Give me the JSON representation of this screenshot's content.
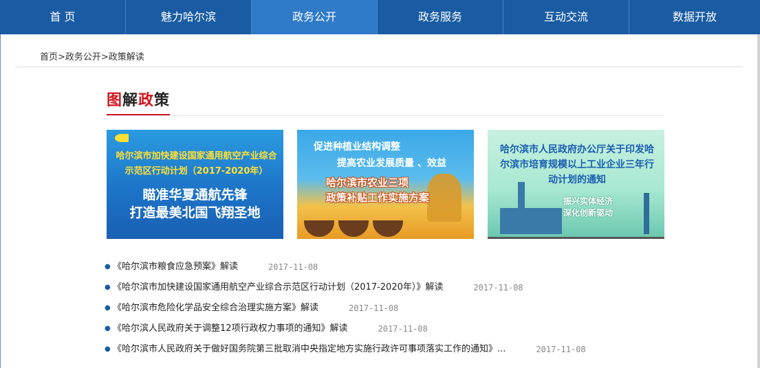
{
  "nav": {
    "items": [
      "首 页",
      "魅力哈尔滨",
      "政务公开",
      "政务服务",
      "互动交流",
      "数据开放"
    ],
    "active_index": 2
  },
  "breadcrumb": "首页>政务公开>政策解读",
  "section_title": {
    "part1": "图",
    "part2": "解",
    "part3": "政",
    "part4": "策"
  },
  "banners": [
    {
      "line1": "哈尔滨市加快建设国家通用航空产业综合示范区行动计划（2017-2020年）",
      "line2": "瞄准华夏通航先锋",
      "line3": "打造最美北国飞翔圣地"
    },
    {
      "line1": "促进种植业结构调整",
      "line2": "提高农业发展质量 、效益",
      "line3": "哈尔滨市农业三项",
      "line4": "政策补贴工作实施方案"
    },
    {
      "line1": "哈尔滨市人民政府办公厅关于印发哈尔滨市培育规模以上工业企业三年行动计划的通知",
      "line2": "振兴实体经济",
      "line3": "深化创新驱动"
    }
  ],
  "items": [
    {
      "title": "《哈尔滨市粮食应急预案》解读",
      "date": "2017-11-08"
    },
    {
      "title": "《哈尔滨市加快建设国家通用航空产业综合示范区行动计划（2017-2020年）》解读",
      "date": "2017-11-08"
    },
    {
      "title": "《哈尔滨市危险化学品安全综合治理实施方案》解读",
      "date": "2017-11-08"
    },
    {
      "title": "《哈尔滨人民政府关于调整12项行政权力事项的通知》解读",
      "date": "2017-11-08"
    },
    {
      "title": "《哈尔滨市人民政府关于做好国务院第三批取消中央指定地方实施行政许可事项落实工作的通知》...",
      "date": "2017-11-08"
    }
  ],
  "colors": {
    "nav": "#1a5ca4",
    "nav_active": "#2f7bc9",
    "accent_red": "#d0141e"
  }
}
